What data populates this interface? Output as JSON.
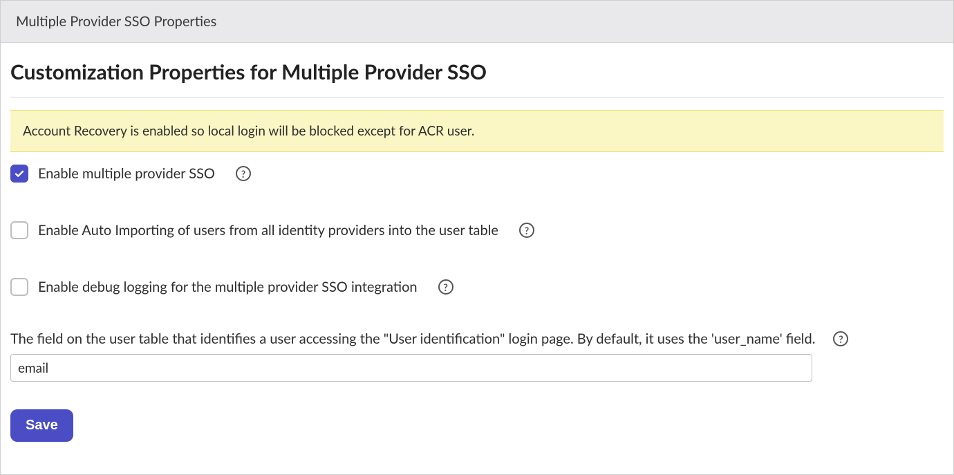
{
  "header": {
    "window_title": "Multiple Provider SSO Properties"
  },
  "page": {
    "title": "Customization Properties for Multiple Provider SSO"
  },
  "banner": {
    "message": "Account Recovery is enabled so local login will be blocked except for ACR user."
  },
  "options": {
    "enable_sso": {
      "label": "Enable multiple provider SSO",
      "checked": true
    },
    "auto_import": {
      "label": "Enable Auto Importing of users from all identity providers into the user table",
      "checked": false
    },
    "debug_log": {
      "label": "Enable debug logging for the multiple provider SSO integration",
      "checked": false
    }
  },
  "user_field": {
    "label": "The field on the user table that identifies a user accessing the \"User identification\" login page. By default, it uses the 'user_name' field.",
    "value": "email"
  },
  "actions": {
    "save_label": "Save"
  },
  "icons": {
    "help_glyph": "?"
  }
}
